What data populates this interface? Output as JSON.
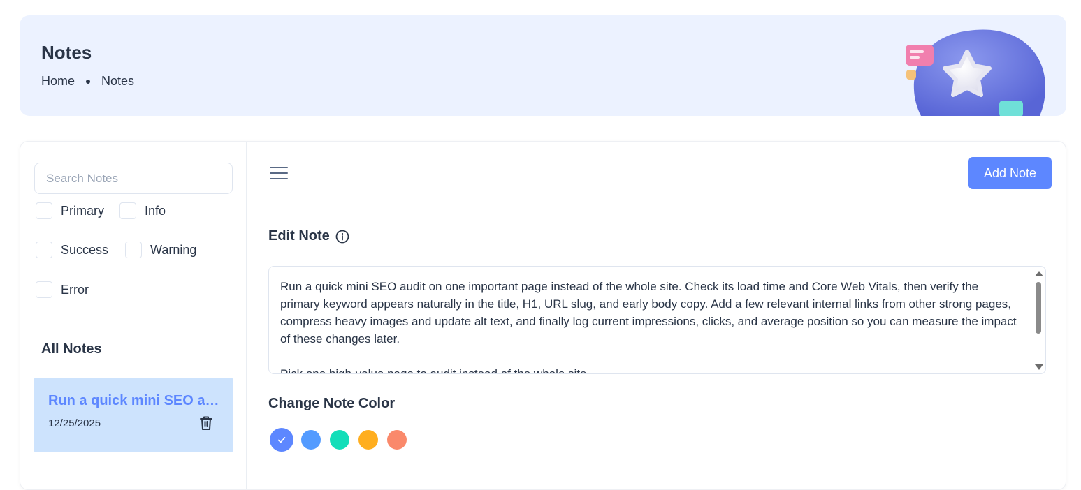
{
  "header": {
    "title": "Notes",
    "breadcrumb": [
      "Home",
      "Notes"
    ]
  },
  "sidebar": {
    "search_placeholder": "Search Notes",
    "filters": [
      {
        "label": "Primary",
        "checked": false
      },
      {
        "label": "Info",
        "checked": false
      },
      {
        "label": "Success",
        "checked": false
      },
      {
        "label": "Warning",
        "checked": false
      },
      {
        "label": "Error",
        "checked": false
      }
    ],
    "all_notes_label": "All Notes",
    "notes": [
      {
        "title": "Run a quick mini SEO audit on one important page instead of the whole site.",
        "date": "12/25/2025"
      }
    ]
  },
  "toolbar": {
    "add_label": "Add Note",
    "menu_icon": "hamburger-icon"
  },
  "editor": {
    "label": "Edit Note",
    "info_icon": "info-icon",
    "paragraphs": [
      "Run a quick mini SEO audit on one important page instead of the whole site. Check its load time and Core Web Vitals, then verify the primary keyword appears naturally in the title, H1, URL slug, and early body copy. Add a few relevant internal links from other strong pages, compress heavy images and update alt text, and finally log current impressions, clicks, and average position so you can measure the impact of these changes later.",
      "Pick one high-value page to audit instead of the whole site."
    ]
  },
  "colors": {
    "label": "Change Note Color",
    "swatches": [
      "#5d87ff",
      "#539bff",
      "#13deb9",
      "#ffae1f",
      "#fa896b"
    ],
    "selected_index": 0
  }
}
